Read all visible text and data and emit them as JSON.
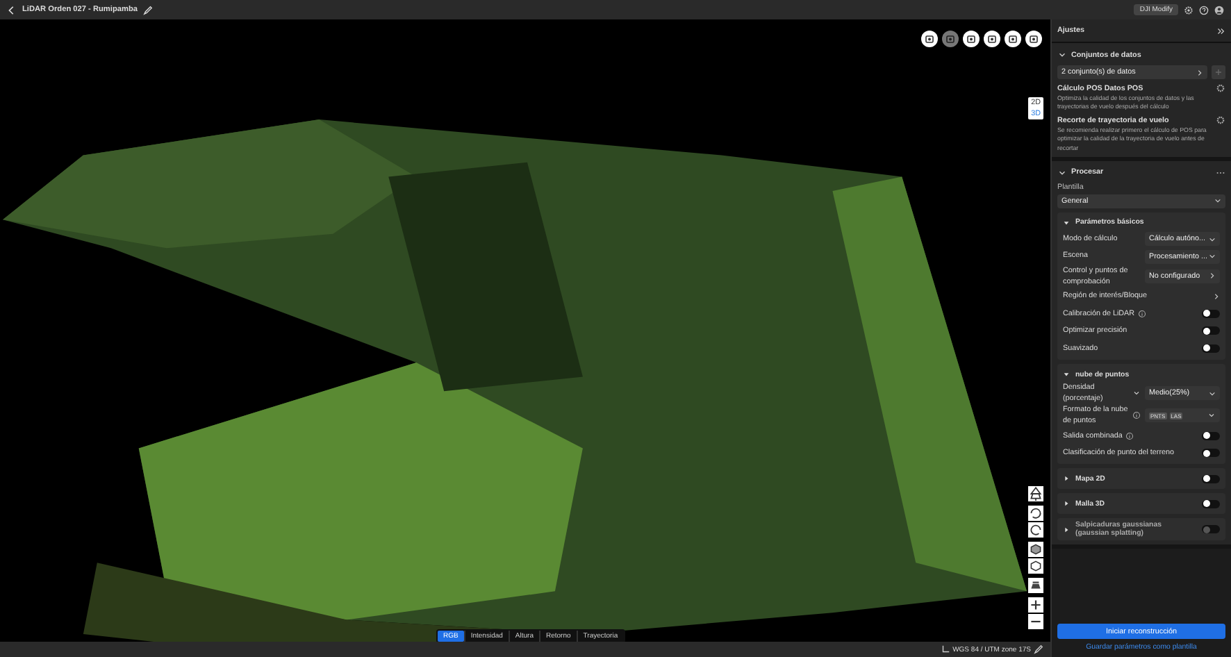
{
  "header": {
    "title": "LiDAR Orden 027 - Rumipamba",
    "badge": "DJI Modify"
  },
  "top_tools": [
    {
      "selected": false
    },
    {
      "selected": true
    },
    {
      "selected": false
    },
    {
      "selected": false
    },
    {
      "selected": false
    },
    {
      "selected": false
    }
  ],
  "view_modes": [
    {
      "label": "2D",
      "selected": false
    },
    {
      "label": "3D",
      "selected": true
    }
  ],
  "color_modes": [
    {
      "label": "RGB",
      "selected": true
    },
    {
      "label": "Intensidad",
      "selected": false
    },
    {
      "label": "Altura",
      "selected": false
    },
    {
      "label": "Retorno",
      "selected": false
    },
    {
      "label": "Trayectoria",
      "selected": false
    }
  ],
  "status_bar": {
    "crs": "WGS 84 / UTM zone 17S"
  },
  "panel": {
    "title": "Ajustes",
    "datasets": {
      "title": "Conjuntos de datos",
      "expanded": true,
      "select": "2 conjunto(s) de datos",
      "options": [
        {
          "title": "Cálculo POS Datos POS",
          "description": "Optimiza la calidad de los conjuntos de datos y las trayectorias de vuelo después del cálculo"
        },
        {
          "title": "Recorte de trayectoria de vuelo",
          "description": "Se recomienda realizar primero el cálculo de POS para optimizar la calidad de la trayectoria de vuelo antes de recortar"
        }
      ]
    },
    "process": {
      "title": "Procesar",
      "expanded": true,
      "template_label": "Plantilla",
      "template": "General",
      "groups": [
        {
          "title": "Parámetros básicos",
          "expanded": true,
          "rows": [
            {
              "kind": "select",
              "label": "Modo de cálculo",
              "value": "Cálculo autóno..."
            },
            {
              "kind": "select",
              "label": "Escena",
              "value": "Procesamiento ..."
            },
            {
              "kind": "link-value",
              "label": "Control y puntos de comprobación",
              "value": "No configurado"
            },
            {
              "kind": "link",
              "label": "Región de interés/Bloque"
            },
            {
              "kind": "toggle",
              "label": "Calibración de LiDAR",
              "info": true,
              "on": false
            },
            {
              "kind": "toggle",
              "label": "Optimizar precisión",
              "info": false,
              "on": false
            },
            {
              "kind": "toggle",
              "label": "Suavizado",
              "info": false,
              "on": false
            }
          ]
        },
        {
          "title": "nube de puntos",
          "expanded": true,
          "rows": [
            {
              "kind": "select",
              "label": "Densidad (porcentaje)",
              "value": "Medio(25%)",
              "dropdown": true
            },
            {
              "kind": "tags",
              "label": "Formato de la nube de puntos",
              "info": true,
              "tags": [
                "PNTS",
                "LAS"
              ]
            },
            {
              "kind": "toggle",
              "label": "Salida combinada",
              "info": true,
              "on": false
            },
            {
              "kind": "toggle",
              "label": "Clasificación de punto del terreno",
              "info": false,
              "on": false
            }
          ]
        },
        {
          "title": "Mapa 2D",
          "expanded": false,
          "on": false,
          "disabled": false
        },
        {
          "title": "Malla 3D",
          "expanded": false,
          "on": false,
          "disabled": false
        },
        {
          "title": "Salpicaduras gaussianas (gaussian splatting)",
          "expanded": false,
          "on": false,
          "disabled": true
        }
      ]
    },
    "start_button": "Iniciar reconstrucción",
    "save_link": "Guardar parámetros como plantilla"
  }
}
